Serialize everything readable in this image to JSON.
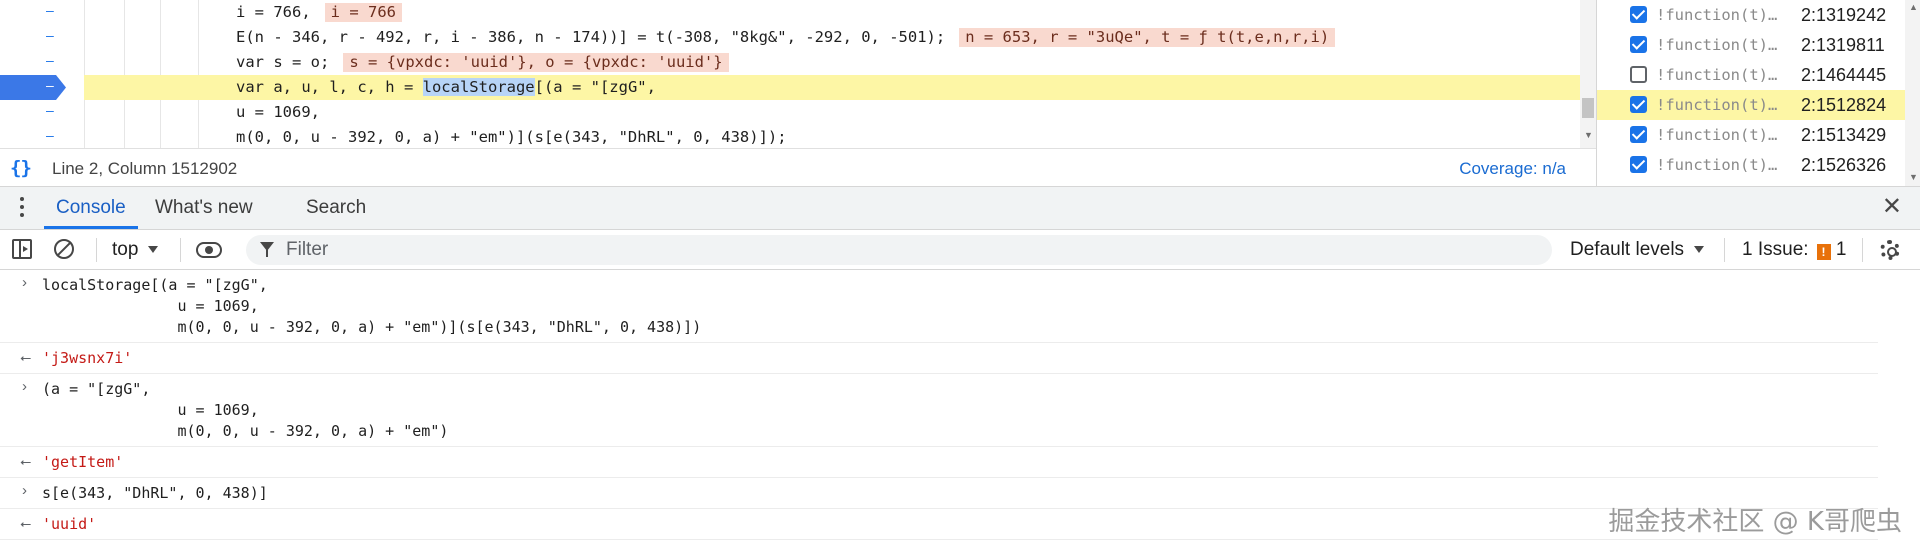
{
  "source": {
    "lines": [
      {
        "text": "i = 766,",
        "hint": "i = 766"
      },
      {
        "text": "E(n - 346, r - 492, r, i - 386, n - 174))] = t(-308, \"8kg&\", -292, 0, -501);",
        "hint": "n = 653, r = \"3uQe\", t = ƒ t(t,e,n,r,i)"
      },
      {
        "text": "var s = o;",
        "hint": "s = {vpxdc: 'uuid'}, o = {vpxdc: 'uuid'}"
      },
      {
        "text_before": "var a, u, l, c, h = ",
        "text_selected": "localStorage",
        "text_after": "[(a = \"[zgG\","
      },
      {
        "text": "u = 1069,"
      },
      {
        "text": "m(0, 0, u - 392, 0, a) + \"em\")](s[e(343, \"DhRL\", 0, 438)]);"
      }
    ],
    "gutter_marker": "–",
    "status": {
      "position": "Line 2, Column 1512902",
      "coverage": "Coverage: n/a"
    }
  },
  "breakpoints": [
    {
      "fn": "!function(t)…",
      "loc": "2:1319242",
      "checked": true
    },
    {
      "fn": "!function(t)…",
      "loc": "2:1319811",
      "checked": true
    },
    {
      "fn": "!function(t)…",
      "loc": "2:1464445",
      "checked": false
    },
    {
      "fn": "!function(t)…",
      "loc": "2:1512824",
      "checked": true
    },
    {
      "fn": "!function(t)…",
      "loc": "2:1513429",
      "checked": true
    },
    {
      "fn": "!function(t)…",
      "loc": "2:1526326",
      "checked": true
    }
  ],
  "drawer": {
    "tabs": [
      "Console",
      "What's new",
      "Search"
    ],
    "active_tab": "Console"
  },
  "toolbar": {
    "context": "top",
    "filter_placeholder": "Filter",
    "levels": "Default levels",
    "issues_label": "1 Issue:",
    "issues_count": "1"
  },
  "console": {
    "entries": [
      {
        "type": "input",
        "text": "localStorage[(a = \"[zgG\",\n               u = 1069,\n               m(0, 0, u - 392, 0, a) + \"em\")](s[e(343, \"DhRL\", 0, 438)])"
      },
      {
        "type": "result",
        "text": "'j3wsnx7i'"
      },
      {
        "type": "input",
        "text": "(a = \"[zgG\",\n               u = 1069,\n               m(0, 0, u - 392, 0, a) + \"em\")"
      },
      {
        "type": "result",
        "text": "'getItem'"
      },
      {
        "type": "input",
        "text": "s[e(343, \"DhRL\", 0, 438)]"
      },
      {
        "type": "result",
        "text": "'uuid'"
      }
    ]
  },
  "watermark": "掘金技术社区 @ K哥爬虫",
  "colors": {
    "accent": "#1a73e8",
    "paused_line": "#fdf6a5",
    "inline_hint_bg": "#f9d9cf",
    "string": "#a31515",
    "number": "#1750eb",
    "result_string": "#c41a16"
  }
}
